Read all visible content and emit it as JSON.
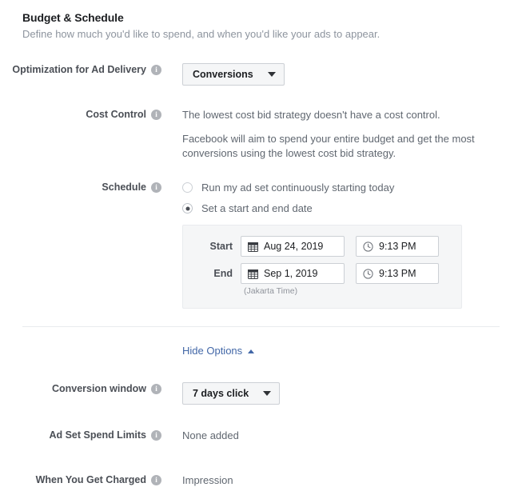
{
  "section": {
    "title": "Budget & Schedule",
    "subtitle": "Define how much you'd like to spend, and when you'd like your ads to appear."
  },
  "optimization": {
    "label": "Optimization for Ad Delivery",
    "info_icon": "info-icon",
    "value": "Conversions"
  },
  "cost_control": {
    "label": "Cost Control",
    "info_icon": "info-icon",
    "paragraph1": "The lowest cost bid strategy doesn't have a cost control.",
    "paragraph2": "Facebook will aim to spend your entire budget and get the most conversions using the lowest cost bid strategy."
  },
  "schedule": {
    "label": "Schedule",
    "info_icon": "info-icon",
    "options": [
      {
        "label": "Run my ad set continuously starting today",
        "selected": false
      },
      {
        "label": "Set a start and end date",
        "selected": true
      }
    ],
    "dates": {
      "start_label": "Start",
      "start_date": "Aug 24, 2019",
      "start_time": "9:13 PM",
      "end_label": "End",
      "end_date": "Sep 1, 2019",
      "end_time": "9:13 PM",
      "timezone_note": "(Jakarta Time)",
      "calendar_icon": "calendar-icon",
      "clock_icon": "clock-icon"
    }
  },
  "hide_options": {
    "label": "Hide Options",
    "caret_icon": "caret-up-icon"
  },
  "conversion_window": {
    "label": "Conversion window",
    "info_icon": "info-icon",
    "value": "7 days click"
  },
  "spend_limits": {
    "label": "Ad Set Spend Limits",
    "info_icon": "info-icon",
    "value": "None added"
  },
  "when_charged": {
    "label": "When You Get Charged",
    "info_icon": "info-icon",
    "value": "Impression"
  },
  "colors": {
    "link": "#4267a7",
    "label_text": "#4b4f56",
    "body_text": "#606770",
    "muted_text": "#8d949e",
    "border": "#ccd0d5",
    "panel_bg": "#f5f6f7",
    "divider": "#e9ebee"
  }
}
